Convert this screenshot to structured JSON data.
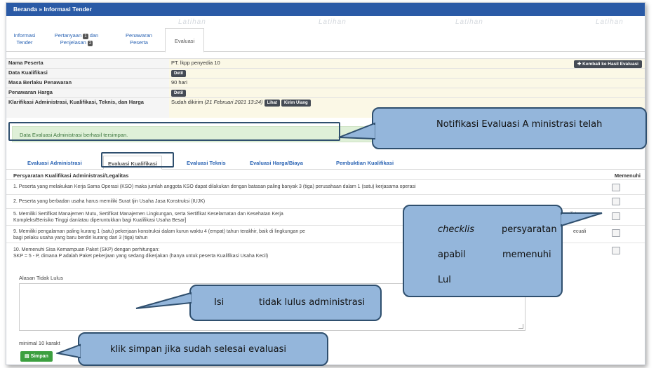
{
  "breadcrumb": "Beranda » Informasi Tender",
  "watermark": "Latihan",
  "subtabs": [
    {
      "label": "Informasi Tender"
    },
    {
      "label": "Pertanyaan",
      "badge": "1",
      "label2": "dan",
      "label3": "Penjelasan",
      "badge2": "2"
    },
    {
      "label": "Penawaran Peserta"
    },
    {
      "label": "Evaluasi"
    }
  ],
  "info": {
    "rows": [
      {
        "label": "Nama Peserta",
        "value": "PT. lkpp penyedia 10"
      },
      {
        "label": "Data Kualifikasi",
        "button": "Detil"
      },
      {
        "label": "Masa Berlaku Penawaran",
        "value": "90 hari"
      },
      {
        "label": "Penawaran Harga",
        "button": "Detil"
      },
      {
        "label": "Klarifikasi Administrasi, Kualifikasi, Teknis, dan Harga",
        "value": "Sudah dikirim",
        "date": "(21 Februari 2021 13:24)",
        "btn1": "Lihat",
        "btn2": "Kirim Ulang"
      }
    ],
    "back_button": "Kembali ke Hasil Evaluasi"
  },
  "alert": "Data Evaluasi Administrasi berhasil tersimpan.",
  "eval_tabs": [
    "Evaluasi Administrasi",
    "Evaluasi Kualifikasi",
    "Evaluasi Teknis",
    "Evaluasi Harga/Biaya",
    "Pembuktian Kualifikasi"
  ],
  "requirements": {
    "title": "Persyaratan Kualifikasi Administrasi/Legalitas",
    "column": "Memenuhi",
    "items": [
      {
        "text": "1. Peserta yang melakukan Kerja Sama Operasi (KSO) maka jumlah anggota KSO dapat dilakukan dengan batasan paling banyak 3 (tiga) perusahaan dalam 1 (satu) kerjasama operasi"
      },
      {
        "text": "2. Peserta yang berbadan usaha harus memiliki Surat Ijin Usaha Jasa Konstruksi (IUJK)"
      },
      {
        "text": "5. Memiliki Sertifikat Manajemen Mutu, Sertifikat Manajemen Lingkungan, serta Sertifikat Keselamatan dan Kesehatan Kerja",
        "text_end": "ng bersifat",
        "line2": "Kompleks/Berisiko Tinggi dan/atau diperuntukkan bagi Kualifikasi Usaha Besar]"
      },
      {
        "text": "9. Memiliki pengalaman paling kurang 1 (satu) pekerjaan konstruksi dalam kurun waktu 4 (empat) tahun terakhir, baik di lingkungan pe",
        "text_end": "ecuali",
        "line2": "bagi pelaku usaha yang baru berdiri kurang dari 3 (tiga) tahun"
      },
      {
        "text": "10. Memenuhi Sisa Kemampuan Paket (SKP) dengan perhitungan:",
        "line2": "SKP = 5 - P, dimana P adalah Paket pekerjaan yang sedang dikerjakan (hanya untuk peserta Kualifikasi Usaha Kecil)"
      }
    ]
  },
  "alasan_label": "Alasan Tidak Lulus",
  "minimal_text": "minimal 10 karakt",
  "save_button": "Simpan",
  "callouts": {
    "notifikasi": "Notifikasi Evaluasi A  ministrasi telah",
    "checklis_italic": "checklis",
    "checklis_rest": "persyaratan",
    "apabil": "apabil",
    "memenuhi": "memenuhi",
    "lul": "Lul",
    "isi": "Isi",
    "tidak_lulus": "tidak lulus administrasi",
    "simpan": "klik simpan jika sudah selesai evaluasi"
  },
  "colors": {
    "topbar": "#2a5aa6",
    "callout_fill": "#94b6db",
    "callout_border": "#2f4f6e",
    "alert_bg": "#dff0d8",
    "save_button": "#3c9f3f"
  }
}
